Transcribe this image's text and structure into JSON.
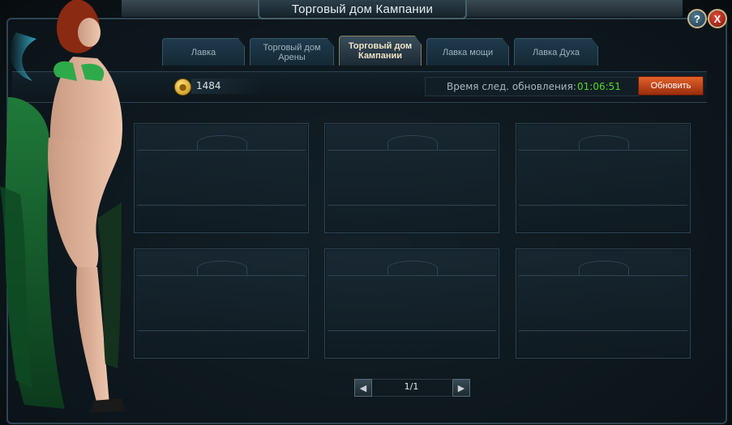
{
  "window": {
    "title": "Торговый дом Кампании",
    "help_label": "?",
    "close_label": "X"
  },
  "tabs": [
    {
      "label": "Лавка",
      "active": false
    },
    {
      "label": "Торговый дом Арены",
      "active": false
    },
    {
      "label": "Торговый дом Кампании",
      "active": true
    },
    {
      "label": "Лавка мощи",
      "active": false
    },
    {
      "label": "Лавка Духа",
      "active": false
    }
  ],
  "currency": {
    "icon": "gold-coin-icon",
    "value": "1484"
  },
  "refresh": {
    "label": "Время след. обновления:",
    "timer": "01:06:51",
    "button_label": "Обновить"
  },
  "slots_count": 6,
  "pager": {
    "text": "1/1",
    "prev_icon": "chevron-left-icon",
    "next_icon": "chevron-right-icon"
  },
  "colors": {
    "timer": "#4fdb26",
    "refresh_button": "#d2501f",
    "active_tab_text": "#f0e4c6",
    "close_button": "#c3291e"
  }
}
